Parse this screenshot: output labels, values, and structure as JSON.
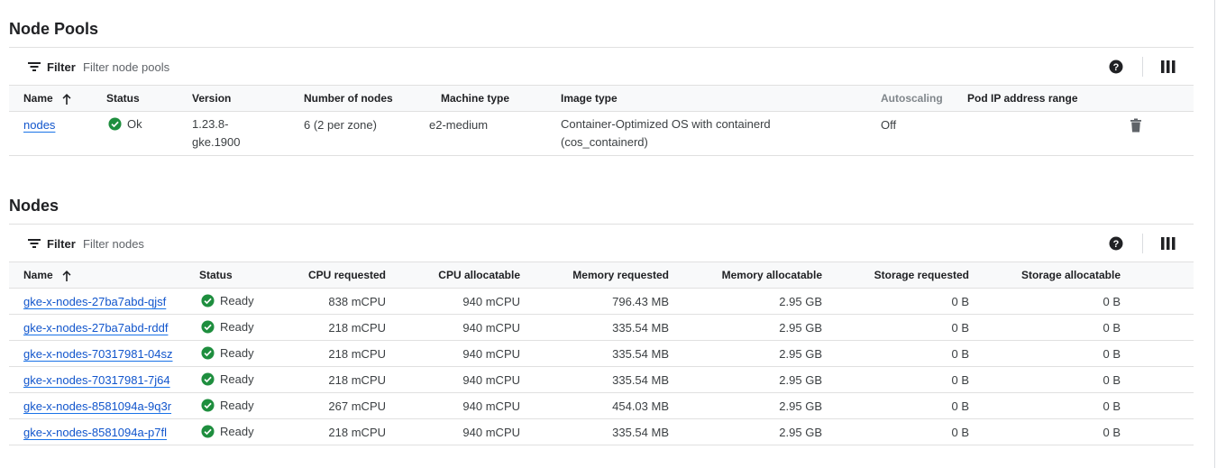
{
  "node_pools": {
    "title": "Node Pools",
    "filter_label": "Filter",
    "filter_placeholder": "Filter node pools",
    "help_icon": "help-circle-icon",
    "columns_icon": "column-display-icon",
    "columns": [
      "Name",
      "Status",
      "Version",
      "Number of nodes",
      "Machine type",
      "Image type",
      "Autoscaling",
      "Pod IP address range"
    ],
    "rows": [
      {
        "name": "nodes",
        "status": "Ok",
        "version_line1": "1.23.8-",
        "version_line2": "gke.1900",
        "num_nodes": "6 (2 per zone)",
        "machine_type": "e2-medium",
        "image_line1": "Container-Optimized OS with containerd",
        "image_line2": "(cos_containerd)",
        "autoscaling": "Off",
        "pod_ip_range": ""
      }
    ]
  },
  "nodes": {
    "title": "Nodes",
    "filter_label": "Filter",
    "filter_placeholder": "Filter nodes",
    "columns": [
      "Name",
      "Status",
      "CPU requested",
      "CPU allocatable",
      "Memory requested",
      "Memory allocatable",
      "Storage requested",
      "Storage allocatable"
    ],
    "rows": [
      {
        "name": "gke-x-nodes-27ba7abd-qjsf",
        "status": "Ready",
        "cpu_req": "838 mCPU",
        "cpu_alloc": "940 mCPU",
        "mem_req": "796.43 MB",
        "mem_alloc": "2.95 GB",
        "sto_req": "0 B",
        "sto_alloc": "0 B"
      },
      {
        "name": "gke-x-nodes-27ba7abd-rddf",
        "status": "Ready",
        "cpu_req": "218 mCPU",
        "cpu_alloc": "940 mCPU",
        "mem_req": "335.54 MB",
        "mem_alloc": "2.95 GB",
        "sto_req": "0 B",
        "sto_alloc": "0 B"
      },
      {
        "name": "gke-x-nodes-70317981-04sz",
        "status": "Ready",
        "cpu_req": "218 mCPU",
        "cpu_alloc": "940 mCPU",
        "mem_req": "335.54 MB",
        "mem_alloc": "2.95 GB",
        "sto_req": "0 B",
        "sto_alloc": "0 B"
      },
      {
        "name": "gke-x-nodes-70317981-7j64",
        "status": "Ready",
        "cpu_req": "218 mCPU",
        "cpu_alloc": "940 mCPU",
        "mem_req": "335.54 MB",
        "mem_alloc": "2.95 GB",
        "sto_req": "0 B",
        "sto_alloc": "0 B"
      },
      {
        "name": "gke-x-nodes-8581094a-9q3r",
        "status": "Ready",
        "cpu_req": "267 mCPU",
        "cpu_alloc": "940 mCPU",
        "mem_req": "454.03 MB",
        "mem_alloc": "2.95 GB",
        "sto_req": "0 B",
        "sto_alloc": "0 B"
      },
      {
        "name": "gke-x-nodes-8581094a-p7fl",
        "status": "Ready",
        "cpu_req": "218 mCPU",
        "cpu_alloc": "940 mCPU",
        "mem_req": "335.54 MB",
        "mem_alloc": "2.95 GB",
        "sto_req": "0 B",
        "sto_alloc": "0 B"
      }
    ]
  },
  "colors": {
    "link": "#1155cc",
    "success": "#1e8e3e",
    "header_bg": "#f8f9fa",
    "border": "#e0e0e0"
  }
}
